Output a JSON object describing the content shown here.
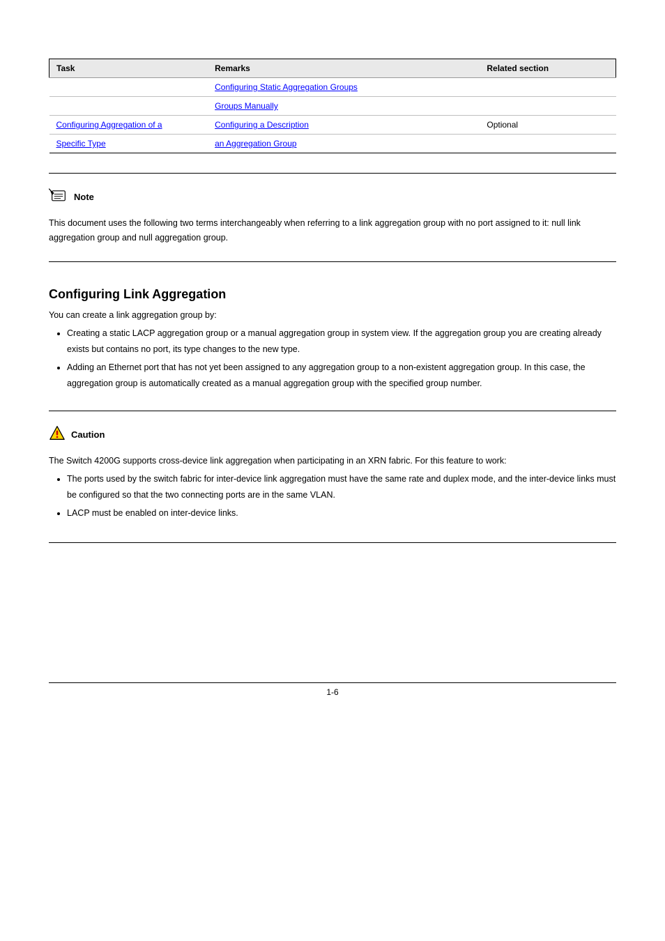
{
  "table": {
    "headers": {
      "c1": "Task",
      "c2": "Remarks",
      "c3": "Related section"
    },
    "rows": [
      {
        "col1": "",
        "col2_link": "Configuring Static Aggregation Groups",
        "col3": ""
      },
      {
        "col1": "",
        "col2_link": "Groups Manually",
        "col3": ""
      },
      {
        "col1_link": "Configuring Aggregation of a",
        "col2_link": "Configuring a Description",
        "col3": "Optional"
      },
      {
        "col1_link": "Specific Type",
        "col2_link": "an Aggregation Group",
        "col3": ""
      }
    ],
    "caption_blank": ""
  },
  "note": {
    "label": "Note",
    "body": "This document uses the following two terms interchangeably when referring to a link aggregation group with no port assigned to it: null link aggregation group and null aggregation group."
  },
  "section": {
    "heading": "Configuring Link Aggregation",
    "p1": "You can create a link aggregation group by:",
    "bullets1": [
      "Creating a static LACP aggregation group or a manual aggregation group in system view. If the aggregation group you are creating already exists but contains no port, its type changes to the new type.",
      "Adding an Ethernet port that has not yet been assigned to any aggregation group to a non-existent aggregation group. In this case, the aggregation group is automatically created as a manual aggregation group with the specified group number."
    ]
  },
  "caution": {
    "label": "Caution",
    "body": "The Switch 4200G supports cross-device link aggregation when participating in an XRN fabric. For this feature to work:",
    "bullets": [
      "The ports used by the switch fabric for inter-device link aggregation must have the same rate and duplex mode, and the inter-device links must be configured so that the two connecting ports are in the same VLAN.",
      "LACP must be enabled on inter-device links."
    ]
  },
  "footer": {
    "page": "1-6"
  },
  "icons": {
    "note": "note-icon",
    "caution": "caution-icon"
  }
}
